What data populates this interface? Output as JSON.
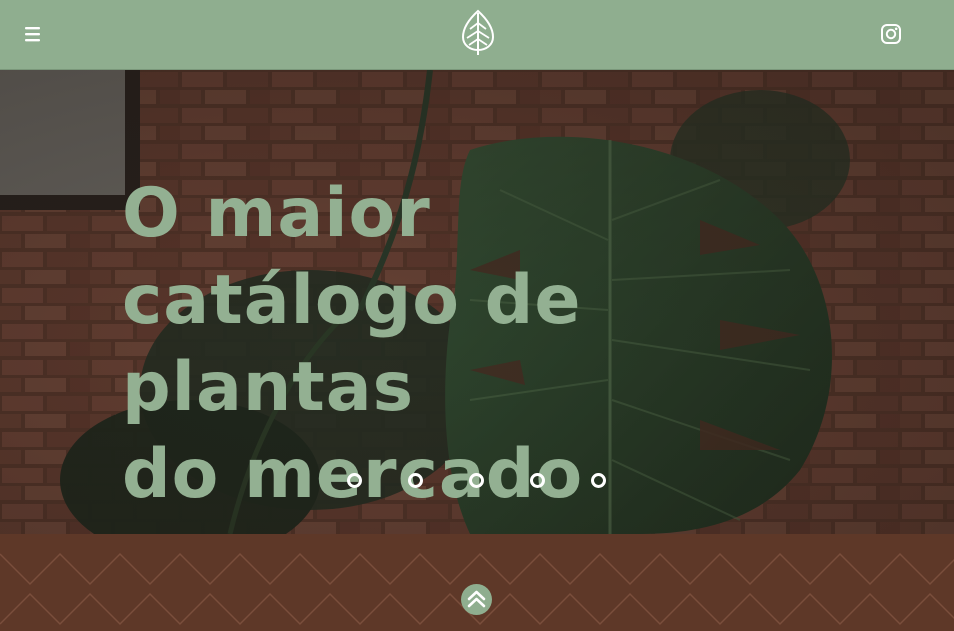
{
  "header": {
    "menu_icon": "hamburger-menu-icon",
    "logo_icon": "leaf-logo-icon",
    "social_icon": "instagram-icon",
    "background_color": "#8fae8f"
  },
  "hero": {
    "headline_lines": [
      "O maior",
      "catálogo de",
      "plantas",
      "do mercado"
    ],
    "headline_color": "#93b092",
    "slides": {
      "count": 5,
      "active": 0
    }
  },
  "footer": {
    "background_color": "#5e3828",
    "pattern": "zigzag-chevron",
    "back_to_top_icon": "chevron-up-icon"
  }
}
